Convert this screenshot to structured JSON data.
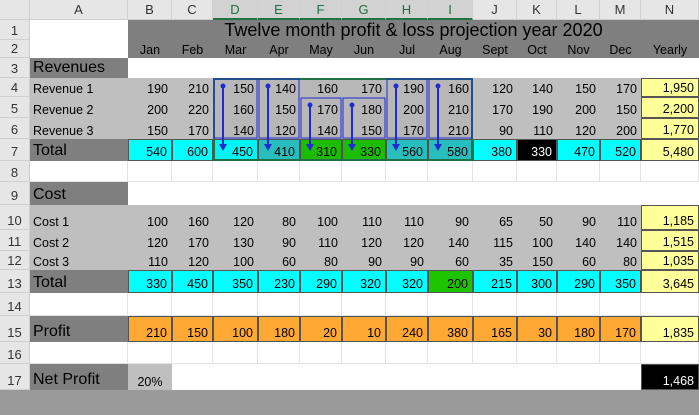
{
  "sheet": {
    "title": "Twelve month profit & loss projection year 2020",
    "columns": [
      "A",
      "B",
      "C",
      "D",
      "E",
      "F",
      "G",
      "H",
      "I",
      "J",
      "K",
      "L",
      "M",
      "N"
    ],
    "rows": [
      "1",
      "2",
      "3",
      "4",
      "5",
      "6",
      "7",
      "8",
      "9",
      "10",
      "11",
      "12",
      "13",
      "14",
      "15",
      "16",
      "17"
    ],
    "months": [
      "Jan",
      "Feb",
      "Mar",
      "Apr",
      "May",
      "Jun",
      "Jul",
      "Aug",
      "Sept",
      "Oct",
      "Nov",
      "Dec"
    ],
    "yearly_label": "Yearly",
    "revenues_heading": "Revenues",
    "revenue_rows": [
      {
        "label": "Revenue 1",
        "values": [
          "190",
          "210",
          "150",
          "140",
          "160",
          "170",
          "190",
          "160",
          "120",
          "140",
          "150",
          "170"
        ],
        "yearly": "1,950"
      },
      {
        "label": "Revenue 2",
        "values": [
          "200",
          "220",
          "160",
          "150",
          "170",
          "180",
          "200",
          "210",
          "170",
          "190",
          "200",
          "150"
        ],
        "yearly": "2,200"
      },
      {
        "label": "Revenue 3",
        "values": [
          "150",
          "170",
          "140",
          "120",
          "140",
          "150",
          "170",
          "210",
          "90",
          "110",
          "120",
          "200"
        ],
        "yearly": "1,770"
      }
    ],
    "revenue_total": {
      "label": "Total",
      "values": [
        "540",
        "600",
        "450",
        "410",
        "310",
        "330",
        "560",
        "580",
        "380",
        "330",
        "470",
        "520"
      ],
      "yearly": "5,480"
    },
    "cost_heading": "Cost",
    "cost_rows": [
      {
        "label": "Cost 1",
        "values": [
          "100",
          "160",
          "120",
          "80",
          "100",
          "110",
          "110",
          "90",
          "65",
          "50",
          "90",
          "110"
        ],
        "yearly": "1,185"
      },
      {
        "label": "Cost 2",
        "values": [
          "120",
          "170",
          "130",
          "90",
          "110",
          "120",
          "120",
          "140",
          "115",
          "100",
          "140",
          "140"
        ],
        "yearly": "1,515"
      },
      {
        "label": "Cost 3",
        "values": [
          "110",
          "120",
          "100",
          "60",
          "80",
          "90",
          "90",
          "60",
          "35",
          "150",
          "60",
          "80"
        ],
        "yearly": "1,035"
      }
    ],
    "cost_total": {
      "label": "Total",
      "values": [
        "330",
        "450",
        "350",
        "230",
        "290",
        "320",
        "320",
        "200",
        "215",
        "300",
        "290",
        "350"
      ],
      "yearly": "3,645"
    },
    "profit": {
      "label": "Profit",
      "values": [
        "210",
        "150",
        "100",
        "180",
        "20",
        "10",
        "240",
        "380",
        "165",
        "30",
        "180",
        "170"
      ],
      "yearly": "1,835"
    },
    "net_profit": {
      "label": "Net Profit",
      "rate": "20%",
      "value": "1,468"
    }
  },
  "colors": {
    "section_gray": "#7f7f7f",
    "data_gray": "#bfbfbf",
    "total_cyan": "#00ffff",
    "highlight_teal": "#2bc6c6",
    "highlight_green": "#1ec400",
    "black": "#000000",
    "profit_orange": "#ffa833",
    "yearly_yellow": "#ffff99",
    "arrow_blue": "#1f2bd1"
  }
}
